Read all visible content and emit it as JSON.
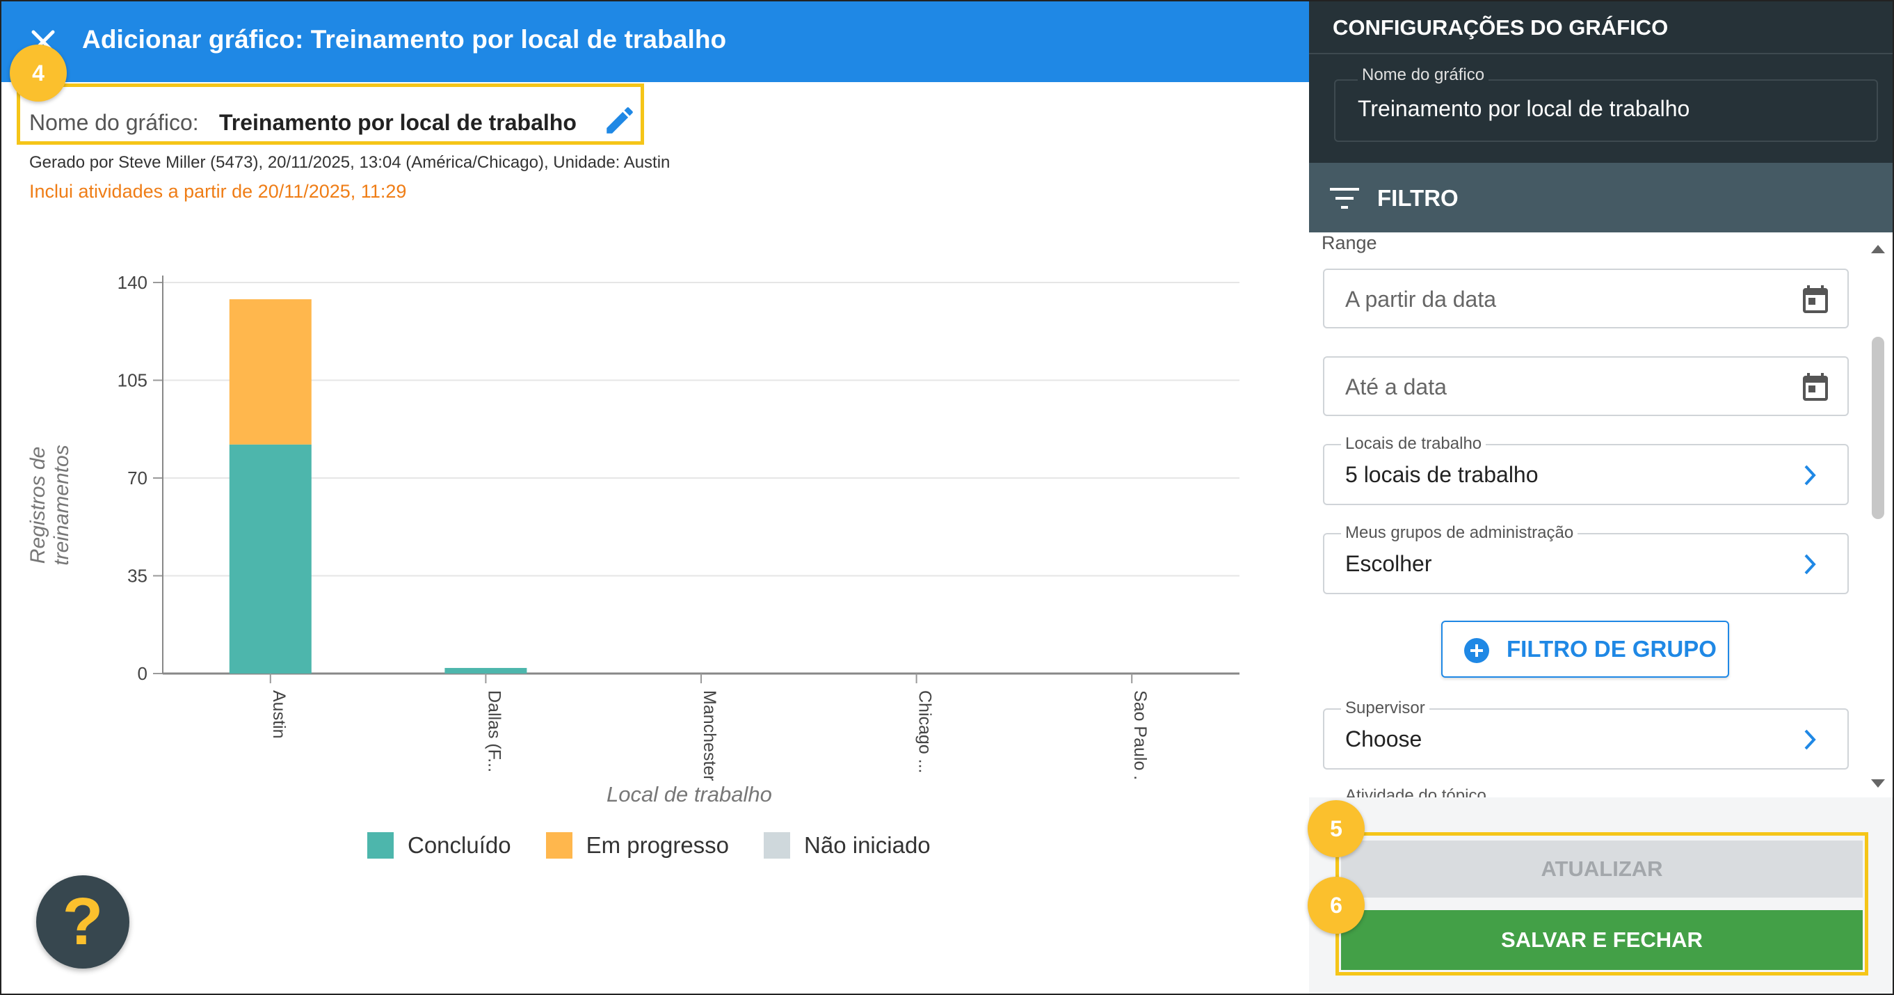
{
  "header": {
    "title": "Adicionar gráfico: Treinamento por local de trabalho"
  },
  "badges": {
    "b4": "4",
    "b5": "5",
    "b6": "6"
  },
  "chart_name": {
    "label": "Nome do gráfico:",
    "value": "Treinamento por local de trabalho"
  },
  "meta": {
    "generated": "Gerado por Steve Miller (5473), 20/11/2025, 13:04 (América/Chicago), Unidade: Austin",
    "includes": "Inclui atividades a partir de 20/11/2025, 11:29"
  },
  "chart_data": {
    "type": "bar",
    "stacked": true,
    "categories": [
      "Austin",
      "Dallas (F...",
      "Manchester",
      "Chicago ...",
      "Sao Paulo ..."
    ],
    "series": [
      {
        "name": "Concluído",
        "color": "#4db6ac",
        "values": [
          82,
          2,
          0,
          0,
          0
        ]
      },
      {
        "name": "Em progresso",
        "color": "#ffb74d",
        "values": [
          52,
          0,
          0,
          0,
          0
        ]
      },
      {
        "name": "Não iniciado",
        "color": "#cfd8dc",
        "values": [
          0,
          0,
          0,
          0,
          0
        ]
      }
    ],
    "yticks": [
      0,
      35,
      70,
      105,
      140
    ],
    "ylim": [
      0,
      140
    ],
    "xlabel": "Local de trabalho",
    "ylabel": "Registros de treinamentos",
    "grid": true,
    "legend": "bottom"
  },
  "help": {
    "glyph": "?"
  },
  "panel": {
    "title": "CONFIGURAÇÕES DO GRÁFICO",
    "name_label": "Nome do gráfico",
    "name_value": "Treinamento por local de trabalho",
    "filter_label": "FILTRO",
    "range_label": "Range",
    "from_placeholder": "A partir da data",
    "to_placeholder": "Até a data",
    "locations_label": "Locais de trabalho",
    "locations_value": "5 locais de trabalho",
    "admin_groups_label": "Meus grupos de administração",
    "admin_groups_value": "Escolher",
    "group_filter_button": "FILTRO DE GRUPO",
    "supervisor_label": "Supervisor",
    "supervisor_value": "Choose",
    "topic_activity_label": "Atividade do tópico",
    "update_button": "ATUALIZAR",
    "save_button": "SALVAR E FECHAR"
  },
  "colors": {
    "header": "#1f88e5",
    "panel_dark": "#263238",
    "filter_bar": "#455a64",
    "save": "#43a047",
    "highlight": "#f5c518",
    "badge": "#fbc02d"
  }
}
